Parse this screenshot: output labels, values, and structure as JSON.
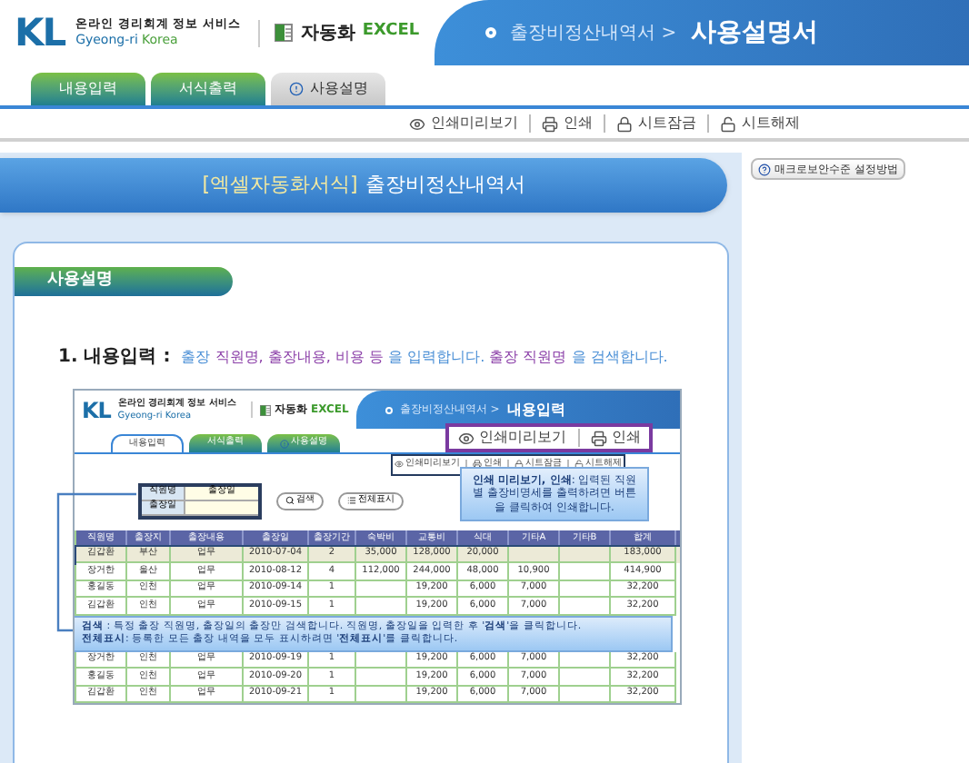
{
  "header": {
    "logo_mark": "KL",
    "logo_title": "온라인 경리회계 정보 서비스",
    "logo_sub": "Gyeong-ri",
    "logo_sub_2": "Korea",
    "product_name": "자동화",
    "product_tag": "EXCEL",
    "breadcrumb": "출장비정산내역서 >",
    "current": "사용설명서"
  },
  "tabs": [
    {
      "label": "내용입력",
      "selected": false
    },
    {
      "label": "서식출력",
      "selected": false
    },
    {
      "label": "사용설명",
      "selected": true
    }
  ],
  "toolbar": [
    {
      "label": "인쇄미리보기",
      "kind": "eye"
    },
    {
      "label": "인쇄",
      "kind": "printer"
    },
    {
      "label": "시트잠금",
      "kind": "lock"
    },
    {
      "label": "시트해제",
      "kind": "unlock"
    }
  ],
  "banner": {
    "bracket": "[엑셀자동화서식]",
    "title": "출장비정산내역서"
  },
  "help_button": "매크로보안수준 설정방법",
  "section_title": "사용설명",
  "step": {
    "label": "1. 내용입력 :",
    "parts": [
      {
        "text": "출장",
        "kind": "plain"
      },
      {
        "text": "직원명, 출장내용, 비용 등",
        "kind": "accent"
      },
      {
        "text": "을 입력합니다.",
        "kind": "plain"
      },
      {
        "text": "출장 직원명",
        "kind": "accent"
      },
      {
        "text": "을 검색합니다.",
        "kind": "plain"
      }
    ]
  },
  "example_screenshot": {
    "header": {
      "logo_mark": "KL",
      "logo_title": "온라인 경리회계 정보 서비스",
      "logo_sub": "Gyeong-ri Korea",
      "product_name": "자동화",
      "product_tag": "EXCEL",
      "breadcrumb": "출장비정산내역서 >",
      "current": "내용입력"
    },
    "tabs": [
      {
        "label": "내용입력",
        "selected": true
      },
      {
        "label": "서식출력",
        "selected": false
      },
      {
        "label": "사용설명",
        "selected": false
      }
    ],
    "toolbar": [
      {
        "label": "인쇄미리보기",
        "kind": "eye"
      },
      {
        "label": "인쇄",
        "kind": "printer"
      },
      {
        "label": "시트잠금",
        "kind": "lock"
      },
      {
        "label": "시트해제",
        "kind": "unlock"
      }
    ],
    "search": {
      "fields": [
        {
          "label": "직원명",
          "value": "출장일"
        },
        {
          "label": "출장일"
        }
      ],
      "buttons": [
        "검색",
        "전체표시"
      ]
    },
    "table": {
      "columns": [
        "직원명",
        "출장지",
        "출장내용",
        "출장일",
        "출장기간",
        "숙박비",
        "교통비",
        "식대",
        "기타A",
        "기타B",
        "합계"
      ],
      "rows_top": [
        {
          "selected": true,
          "cells": [
            "김갑환",
            "부산",
            "업무",
            "2010-07-04",
            "2",
            "35,000",
            "128,000",
            "20,000",
            null,
            null,
            "183,000"
          ]
        },
        {
          "selected": false,
          "cells": [
            "장거한",
            "울산",
            "업무",
            "2010-08-12",
            "4",
            "112,000",
            "244,000",
            "48,000",
            "10,900",
            null,
            "414,900"
          ]
        },
        {
          "selected": false,
          "cells": [
            "홍길동",
            "인천",
            "업무",
            "2010-09-14",
            "1",
            null,
            "19,200",
            "6,000",
            "7,000",
            null,
            "32,200"
          ]
        },
        {
          "selected": false,
          "cells": [
            "김갑환",
            "인천",
            "업무",
            "2010-09-15",
            "1",
            null,
            "19,200",
            "6,000",
            "7,000",
            null,
            "32,200"
          ]
        }
      ],
      "rows_bottom": [
        {
          "selected": false,
          "cells": [
            "장거한",
            "인천",
            "업무",
            "2010-09-19",
            "1",
            null,
            "19,200",
            "6,000",
            "7,000",
            null,
            "32,200"
          ]
        },
        {
          "selected": false,
          "cells": [
            "홍길동",
            "인천",
            "업무",
            "2010-09-20",
            "1",
            null,
            "19,200",
            "6,000",
            "7,000",
            null,
            "32,200"
          ]
        },
        {
          "selected": false,
          "cells": [
            "김갑환",
            "인천",
            "업무",
            "2010-09-21",
            "1",
            null,
            "19,200",
            "6,000",
            "7,000",
            null,
            "32,200"
          ]
        }
      ]
    },
    "print_callout": [
      {
        "label": "인쇄미리보기",
        "kind": "eye"
      },
      {
        "label": "인쇄",
        "kind": "printer"
      }
    ],
    "print_tip": "**인쇄 미리보기, 인쇄**: 입력된 직원별 출장비명세를 출력하려면 버튼을 클릭하여 인쇄합니다.",
    "search_tip": [
      "**검색** : 특정 출장 직원명, 출장일의 출장만 검색합니다. 직원명, 출장일을 입력한 후 '**검색**'을 클릭합니다.",
      "**전체표시**: 등록한 모든 출장 내역을 모두 표시하려면 '**전체표시**'를 클릭합니다."
    ]
  }
}
